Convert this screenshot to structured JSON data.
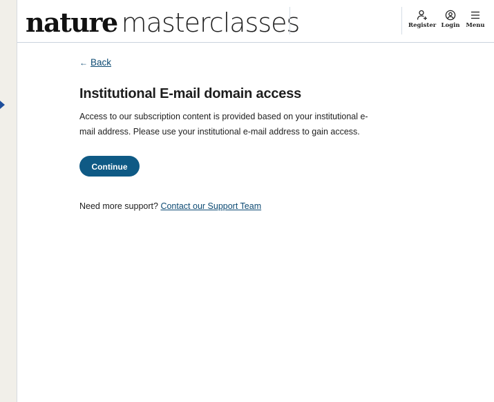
{
  "header": {
    "logo_bold": "nature",
    "logo_light": "masterclasses",
    "nav": {
      "register_label": "Register",
      "login_label": "Login",
      "menu_label": "Menu"
    },
    "icons": [
      "register-icon",
      "login-icon",
      "menu-icon"
    ]
  },
  "main": {
    "back_label": "Back",
    "back_arrow": "←",
    "title": "Institutional E-mail domain access",
    "description": "Access to our subscription content is provided based on your institutional e-mail address. Please use your institutional e-mail address to gain access.",
    "continue_label": "Continue",
    "support_prefix": "Need more support?",
    "support_link": "Contact our Support Team"
  },
  "colors": {
    "primary_button": "#0f5a85",
    "link": "#0c4a73",
    "background_outside": "#f1efe9",
    "arrow_marker": "#1f4f9c"
  }
}
